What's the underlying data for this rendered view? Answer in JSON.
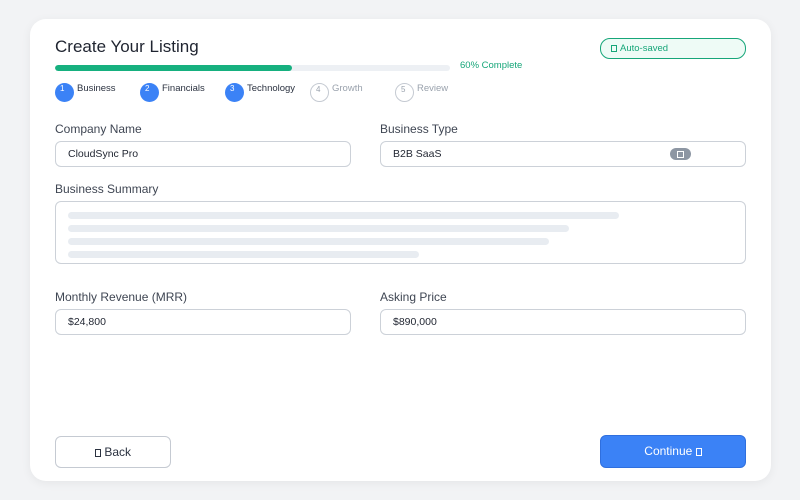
{
  "title": "Create Your Listing",
  "autosave": {
    "label": "Auto-saved",
    "icon": "save-icon"
  },
  "progress": {
    "percent": 60,
    "label": "60% Complete",
    "color": "#16b07f"
  },
  "steps": [
    {
      "num": "1",
      "label": "Business",
      "state": "done"
    },
    {
      "num": "2",
      "label": "Financials",
      "state": "done"
    },
    {
      "num": "3",
      "label": "Technology",
      "state": "done"
    },
    {
      "num": "4",
      "label": "Growth",
      "state": "todo"
    },
    {
      "num": "5",
      "label": "Review",
      "state": "todo"
    }
  ],
  "form": {
    "company_name": {
      "label": "Company Name",
      "value": "CloudSync Pro"
    },
    "business_type": {
      "label": "Business Type",
      "value": "B2B SaaS",
      "icon": "dropdown-icon"
    },
    "business_summary": {
      "label": "Business Summary"
    },
    "mrr": {
      "label": "Monthly Revenue (MRR)",
      "value": "$24,800"
    },
    "asking_price": {
      "label": "Asking Price",
      "value": "$890,000"
    }
  },
  "buttons": {
    "back": "Back",
    "continue": "Continue"
  },
  "colors": {
    "accent": "#3b82f6",
    "success": "#16a679"
  }
}
